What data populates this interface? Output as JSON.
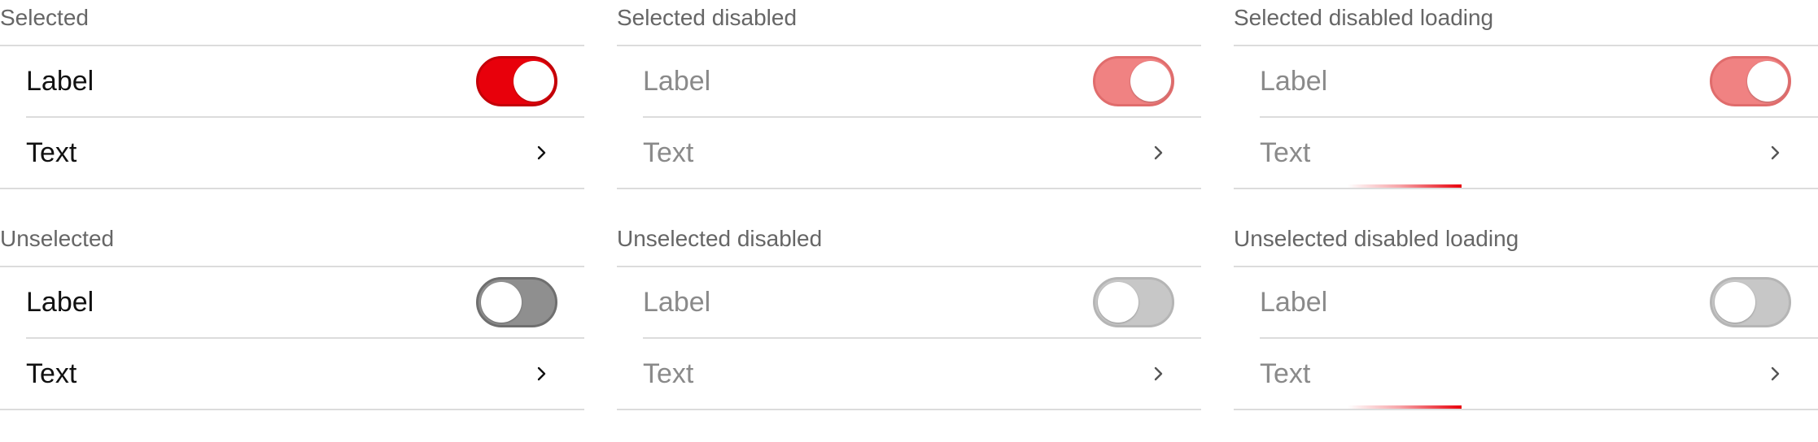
{
  "colors": {
    "accent": "#e8000b",
    "accent_disabled": "#f08282",
    "track_off": "#8f8f8f",
    "track_off_disabled": "#c7c7c7",
    "divider": "#dcdcdc",
    "caption_text": "#666666"
  },
  "icons": {
    "chevron": "chevron-right-icon",
    "toggle": "toggle-switch"
  },
  "groups": [
    {
      "caption": "Selected",
      "toggle_row": {
        "label": "Label",
        "checked": true,
        "disabled": false
      },
      "link_row": {
        "text": "Text"
      },
      "loading": false
    },
    {
      "caption": "Selected disabled",
      "toggle_row": {
        "label": "Label",
        "checked": true,
        "disabled": true
      },
      "link_row": {
        "text": "Text"
      },
      "loading": false
    },
    {
      "caption": "Selected disabled loading",
      "toggle_row": {
        "label": "Label",
        "checked": true,
        "disabled": true
      },
      "link_row": {
        "text": "Text"
      },
      "loading": true
    },
    {
      "caption": "Unselected",
      "toggle_row": {
        "label": "Label",
        "checked": false,
        "disabled": false
      },
      "link_row": {
        "text": "Text"
      },
      "loading": false
    },
    {
      "caption": "Unselected disabled",
      "toggle_row": {
        "label": "Label",
        "checked": false,
        "disabled": true
      },
      "link_row": {
        "text": "Text"
      },
      "loading": false
    },
    {
      "caption": "Unselected disabled loading",
      "toggle_row": {
        "label": "Label",
        "checked": false,
        "disabled": true
      },
      "link_row": {
        "text": "Text"
      },
      "loading": true
    }
  ]
}
